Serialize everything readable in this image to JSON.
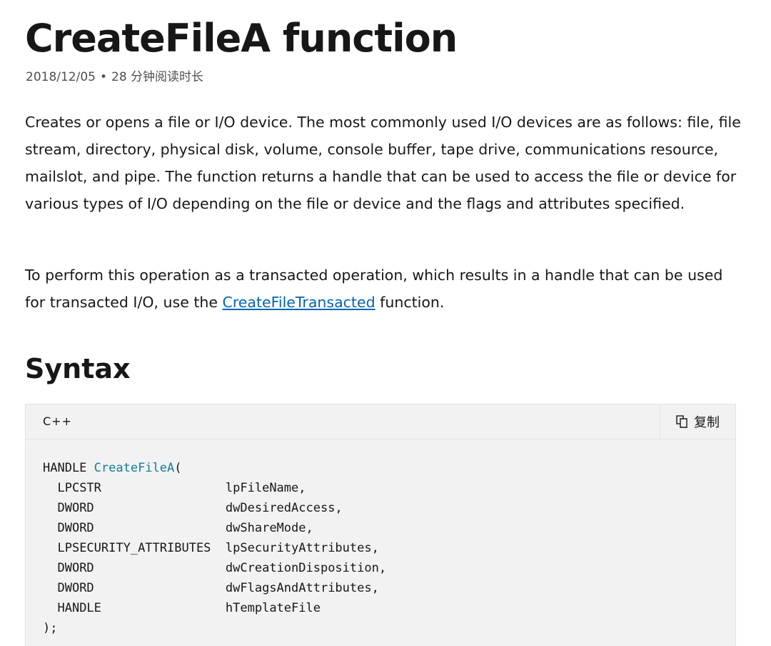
{
  "header": {
    "title": "CreateFileA function",
    "date": "2018/12/05",
    "separator": "•",
    "read_time": "28 分钟阅读时长"
  },
  "intro": {
    "paragraph1": "Creates or opens a file or I/O device. The most commonly used I/O devices are as follows: file, file stream, directory, physical disk, volume, console buffer, tape drive, communications resource, mailslot, and pipe. The function returns a handle that can be used to access the file or device for various types of I/O depending on the file or device and the flags and attributes specified.",
    "paragraph2_before": "To perform this operation as a transacted operation, which results in a handle that can be used for transacted I/O, use the ",
    "paragraph2_link": "CreateFileTransacted",
    "paragraph2_after": " function."
  },
  "syntax": {
    "heading": "Syntax",
    "language": "C++",
    "copy_label": "复制",
    "copy_icon": "copy-icon",
    "code": {
      "return_type": "HANDLE ",
      "function_name": "CreateFileA",
      "open": "(",
      "params": [
        {
          "type": "LPCSTR",
          "name": "lpFileName,"
        },
        {
          "type": "DWORD",
          "name": "dwDesiredAccess,"
        },
        {
          "type": "DWORD",
          "name": "dwShareMode,"
        },
        {
          "type": "LPSECURITY_ATTRIBUTES",
          "name": "lpSecurityAttributes,"
        },
        {
          "type": "DWORD",
          "name": "dwCreationDisposition,"
        },
        {
          "type": "DWORD",
          "name": "dwFlagsAndAttributes,"
        },
        {
          "type": "HANDLE",
          "name": "hTemplateFile"
        }
      ],
      "close": ");"
    }
  },
  "colors": {
    "link": "#0065b3",
    "code_function": "#0e7fa0",
    "code_background": "#f2f2f2"
  }
}
